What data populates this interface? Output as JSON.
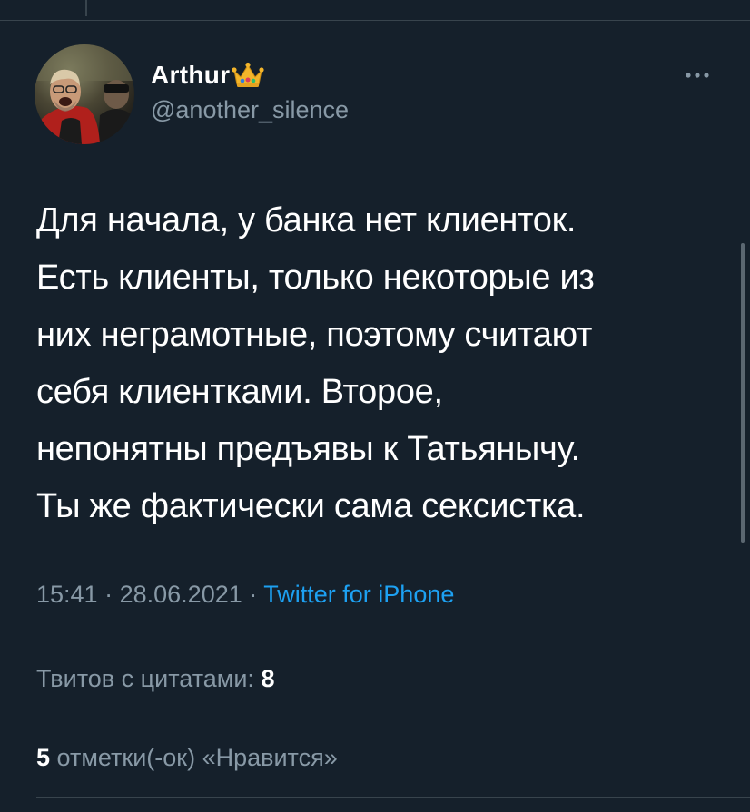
{
  "user": {
    "display_name": "Arthur",
    "handle": "@another_silence",
    "badge_icon": "crown-icon"
  },
  "tweet": {
    "lines": [
      "Для начала, у банка нет клиенток.",
      "Есть клиенты, только некоторые из",
      "них неграмотные, поэтому считают",
      "себя клиентками. Второе,",
      "непонятны предъявы к Татьянычу.",
      "Ты же фактически сама сексистка."
    ],
    "time": "15:41",
    "separator": "·",
    "date": "28.06.2021",
    "source": "Twitter for iPhone"
  },
  "stats": {
    "quote_label": "Твитов с цитатами:",
    "quote_count": "8",
    "likes_count": "5",
    "likes_label": "отметки(-ок) «Нравится»"
  },
  "colors": {
    "background": "#15202b",
    "secondary_text": "#8899a6",
    "link": "#1da1f2",
    "divider": "#38444d"
  }
}
